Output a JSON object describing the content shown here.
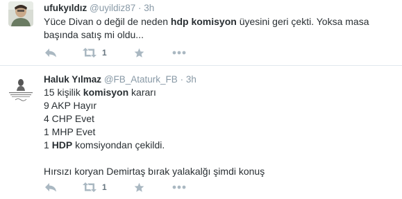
{
  "tweets": [
    {
      "fullname": "ufukyıldız",
      "username": "@uyildiz87",
      "separator": "·",
      "time": "3h",
      "text_segments": [
        {
          "t": "Yüce Divan o değil de neden ",
          "b": false
        },
        {
          "t": "hdp komisyon",
          "b": true
        },
        {
          "t": " üyesini geri çekti. Yoksa masa başında satış mi oldu...",
          "b": false
        }
      ],
      "retweet_count": "1",
      "icons": {
        "reply": "reply-icon",
        "retweet": "retweet-icon",
        "favorite": "star-icon",
        "more": "more-dots-icon"
      }
    },
    {
      "fullname": "Haluk Yılmaz",
      "username": "@FB_Ataturk_FB",
      "separator": "·",
      "time": "3h",
      "lines": [
        [
          {
            "t": "15 kişilik ",
            "b": false
          },
          {
            "t": "komisyon",
            "b": true
          },
          {
            "t": " kararı",
            "b": false
          }
        ],
        [
          {
            "t": "9 AKP Hayır",
            "b": false
          }
        ],
        [
          {
            "t": "4 CHP Evet",
            "b": false
          }
        ],
        [
          {
            "t": "1 MHP Evet",
            "b": false
          }
        ],
        [
          {
            "t": "1 ",
            "b": false
          },
          {
            "t": "HDP",
            "b": true
          },
          {
            "t": " komsiyondan çekildi.",
            "b": false
          }
        ],
        [],
        [
          {
            "t": "Hırsızı koryan Demirtaş bırak yalakalğı şimdi konuş",
            "b": false
          }
        ]
      ],
      "retweet_count": "1",
      "icons": {
        "reply": "reply-icon",
        "retweet": "retweet-icon",
        "favorite": "star-icon",
        "more": "more-dots-icon"
      }
    }
  ],
  "colors": {
    "text": "#292f33",
    "muted": "#8899a6",
    "icon": "#aab8c2",
    "divider": "#e1e8ed"
  }
}
